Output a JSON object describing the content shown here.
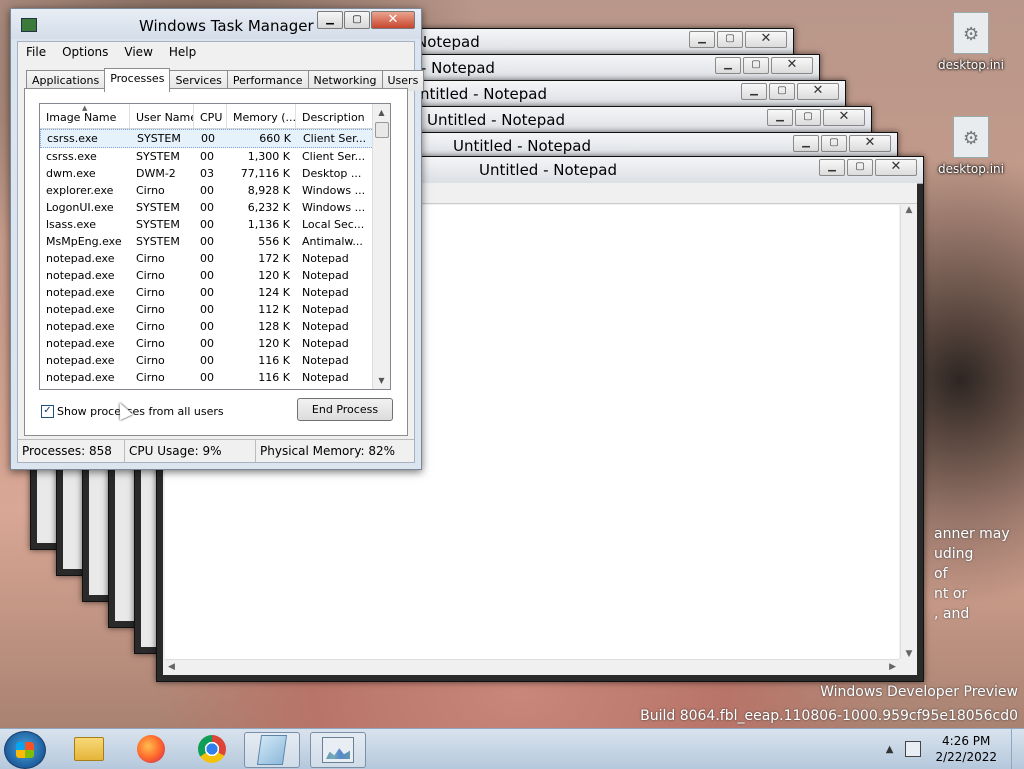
{
  "desktop": {
    "icons": [
      {
        "label": "desktop.ini"
      },
      {
        "label": "desktop.ini"
      }
    ],
    "background_text": [
      "anner may",
      "uding",
      "of",
      "nt or",
      ", and"
    ],
    "watermark": {
      "line1": "Windows Developer Preview",
      "line2": "Build 8064.fbl_eeap.110806-1000.959cf95e18056cd0"
    }
  },
  "notepad_windows": [
    {
      "title": "Notepad"
    },
    {
      "title": "- Notepad"
    },
    {
      "title": "Untitled - Notepad"
    },
    {
      "title": "Untitled - Notepad"
    },
    {
      "title": "Untitled - Notepad"
    },
    {
      "title": "Untitled - Notepad"
    }
  ],
  "task_manager": {
    "title": "Windows Task Manager",
    "menu": [
      "File",
      "Options",
      "View",
      "Help"
    ],
    "tabs": [
      "Applications",
      "Processes",
      "Services",
      "Performance",
      "Networking",
      "Users"
    ],
    "active_tab": "Processes",
    "columns": [
      "Image Name",
      "User Name",
      "CPU",
      "Memory (...",
      "Description"
    ],
    "rows": [
      [
        "csrss.exe",
        "SYSTEM",
        "00",
        "660 K",
        "Client Ser..."
      ],
      [
        "csrss.exe",
        "SYSTEM",
        "00",
        "1,300 K",
        "Client Ser..."
      ],
      [
        "dwm.exe",
        "DWM-2",
        "03",
        "77,116 K",
        "Desktop ..."
      ],
      [
        "explorer.exe",
        "Cirno",
        "00",
        "8,928 K",
        "Windows ..."
      ],
      [
        "LogonUI.exe",
        "SYSTEM",
        "00",
        "6,232 K",
        "Windows ..."
      ],
      [
        "lsass.exe",
        "SYSTEM",
        "00",
        "1,136 K",
        "Local Sec..."
      ],
      [
        "MsMpEng.exe",
        "SYSTEM",
        "00",
        "556 K",
        "Antimalw..."
      ],
      [
        "notepad.exe",
        "Cirno",
        "00",
        "172 K",
        "Notepad"
      ],
      [
        "notepad.exe",
        "Cirno",
        "00",
        "120 K",
        "Notepad"
      ],
      [
        "notepad.exe",
        "Cirno",
        "00",
        "124 K",
        "Notepad"
      ],
      [
        "notepad.exe",
        "Cirno",
        "00",
        "112 K",
        "Notepad"
      ],
      [
        "notepad.exe",
        "Cirno",
        "00",
        "128 K",
        "Notepad"
      ],
      [
        "notepad.exe",
        "Cirno",
        "00",
        "120 K",
        "Notepad"
      ],
      [
        "notepad.exe",
        "Cirno",
        "00",
        "116 K",
        "Notepad"
      ],
      [
        "notepad.exe",
        "Cirno",
        "00",
        "116 K",
        "Notepad"
      ]
    ],
    "show_all_label": "Show processes from all users",
    "show_all_checked": true,
    "end_process_label": "End Process",
    "status": {
      "processes": "Processes: 858",
      "cpu": "CPU Usage: 9%",
      "memory": "Physical Memory: 82%"
    }
  },
  "taskbar": {
    "apps": [
      {
        "icon": "folder-icon"
      },
      {
        "icon": "firefox-icon"
      },
      {
        "icon": "chrome-icon"
      },
      {
        "icon": "notepad-icon"
      },
      {
        "icon": "task-manager-icon"
      }
    ],
    "clock_time": "4:26 PM",
    "clock_date": "2/22/2022"
  }
}
